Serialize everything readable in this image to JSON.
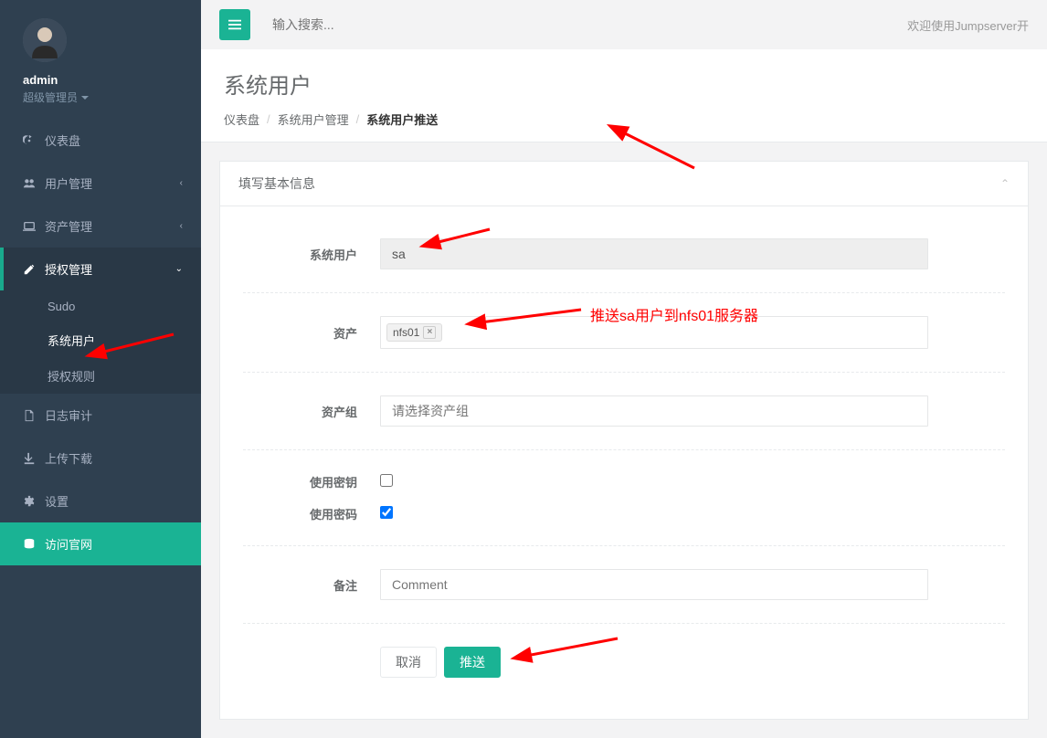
{
  "user": {
    "name": "admin",
    "role": "超级管理员"
  },
  "topbar": {
    "search_placeholder": "输入搜索...",
    "welcome": "欢迎使用Jumpserver开"
  },
  "nav": {
    "dashboard": "仪表盘",
    "user_mgmt": "用户管理",
    "asset_mgmt": "资产管理",
    "perm_mgmt": "授权管理",
    "perm_sub": {
      "sudo": "Sudo",
      "sysuser": "系统用户",
      "rules": "授权规则"
    },
    "audit": "日志审计",
    "updown": "上传下载",
    "settings": "设置",
    "official": "访问官网"
  },
  "page": {
    "title": "系统用户",
    "breadcrumb": {
      "home": "仪表盘",
      "mid": "系统用户管理",
      "current": "系统用户推送"
    }
  },
  "panel": {
    "heading": "填写基本信息"
  },
  "form": {
    "labels": {
      "sysuser": "系统用户",
      "asset": "资产",
      "asset_group": "资产组",
      "use_key": "使用密钥",
      "use_pass": "使用密码",
      "remark": "备注"
    },
    "sysuser_value": "sa",
    "asset_tag": "nfs01",
    "asset_group_placeholder": "请选择资产组",
    "use_key_checked": false,
    "use_pass_checked": true,
    "remark_placeholder": "Comment",
    "buttons": {
      "cancel": "取消",
      "submit": "推送"
    }
  },
  "annotations": {
    "arrow_msg": "推送sa用户到nfs01服务器"
  }
}
